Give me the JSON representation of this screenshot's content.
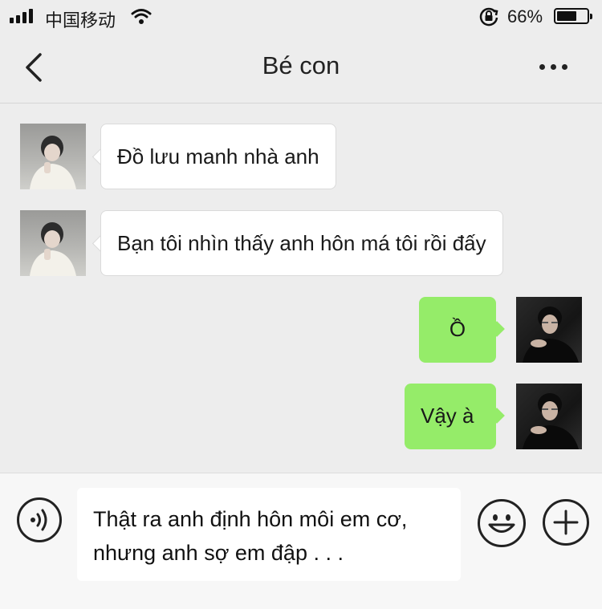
{
  "status_bar": {
    "carrier": "中国移动",
    "battery_percent": "66%",
    "battery_level": 0.66,
    "icons": [
      "signal-icon",
      "wifi-icon",
      "rotation-lock-icon",
      "battery-icon"
    ]
  },
  "header": {
    "back_icon": "chevron-left-icon",
    "title": "Bé con",
    "more_icon": "more-dots-icon"
  },
  "messages": [
    {
      "from": "contact",
      "text": "Đồ lưu manh nhà anh"
    },
    {
      "from": "contact",
      "text": "Bạn tôi nhìn thấy anh hôn má tôi rồi đấy"
    },
    {
      "from": "me",
      "text": "Ồ"
    },
    {
      "from": "me",
      "text": "Vậy à"
    }
  ],
  "input_bar": {
    "voice_icon": "voice-icon",
    "draft_line1": "Thật ra anh định hôn môi em cơ,",
    "draft_line2": "nhưng anh sợ em đập . . .",
    "emoji_icon": "emoji-icon",
    "plus_icon": "plus-icon"
  },
  "colors": {
    "background": "#ededed",
    "outgoing_bubble": "#95ec69",
    "incoming_bubble": "#ffffff"
  }
}
